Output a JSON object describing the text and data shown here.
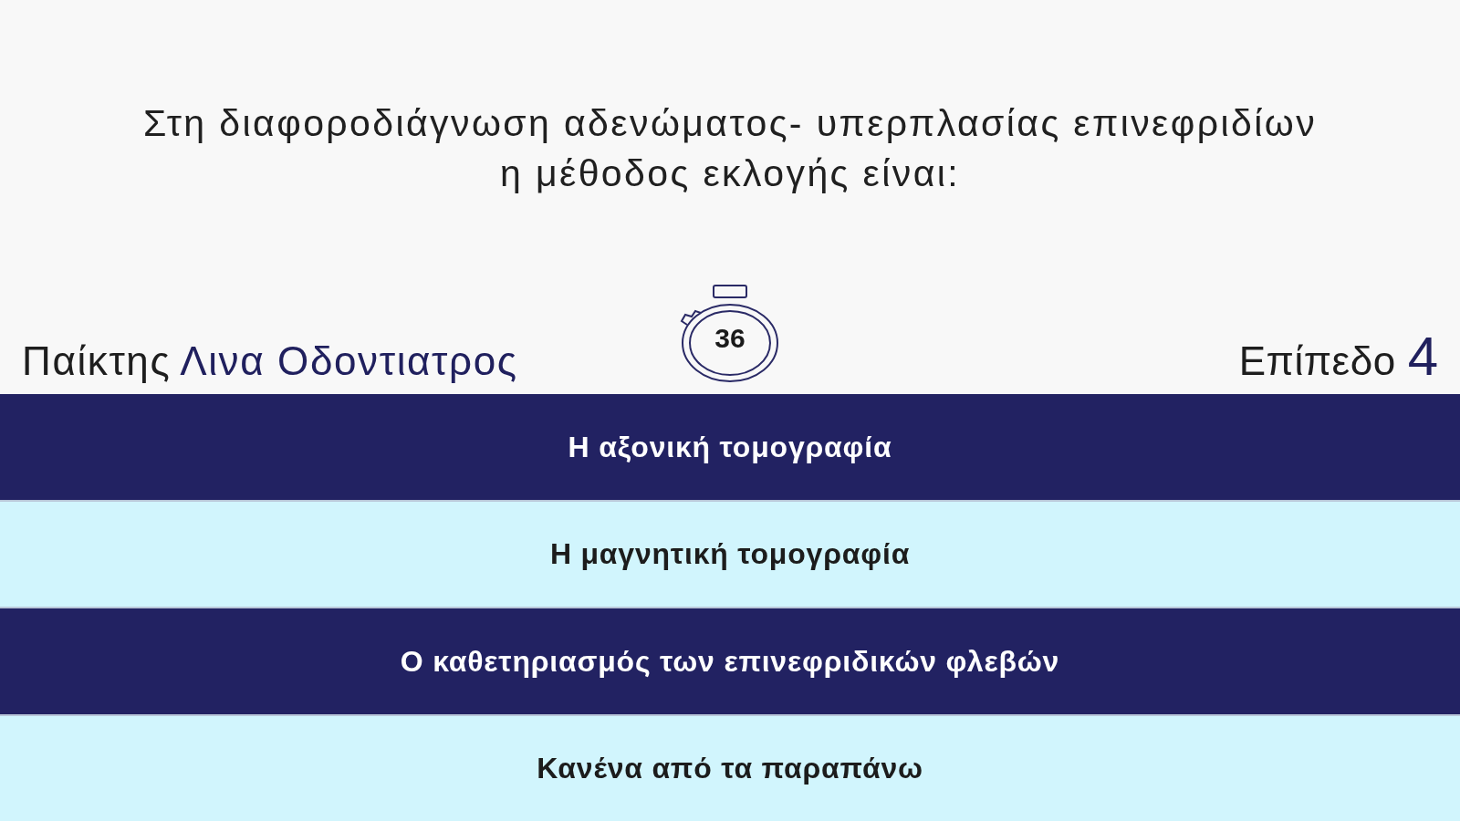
{
  "question": "Στη διαφοροδιάγνωση αδενώματος- υπερπλασίας επινεφριδίων η μέθοδος εκλογής είναι:",
  "player": {
    "label": "Παίκτης",
    "name": "Λινα Οδοντιατρος"
  },
  "timer": {
    "seconds": "36"
  },
  "level": {
    "label": "Επίπεδο",
    "value": "4"
  },
  "answers": [
    "Η αξονική τομογραφία",
    "Η μαγνητική τομογραφία",
    "Ο καθετηριασμός των επινεφριδικών φλεβών",
    "Κανένα από τα παραπάνω"
  ]
}
